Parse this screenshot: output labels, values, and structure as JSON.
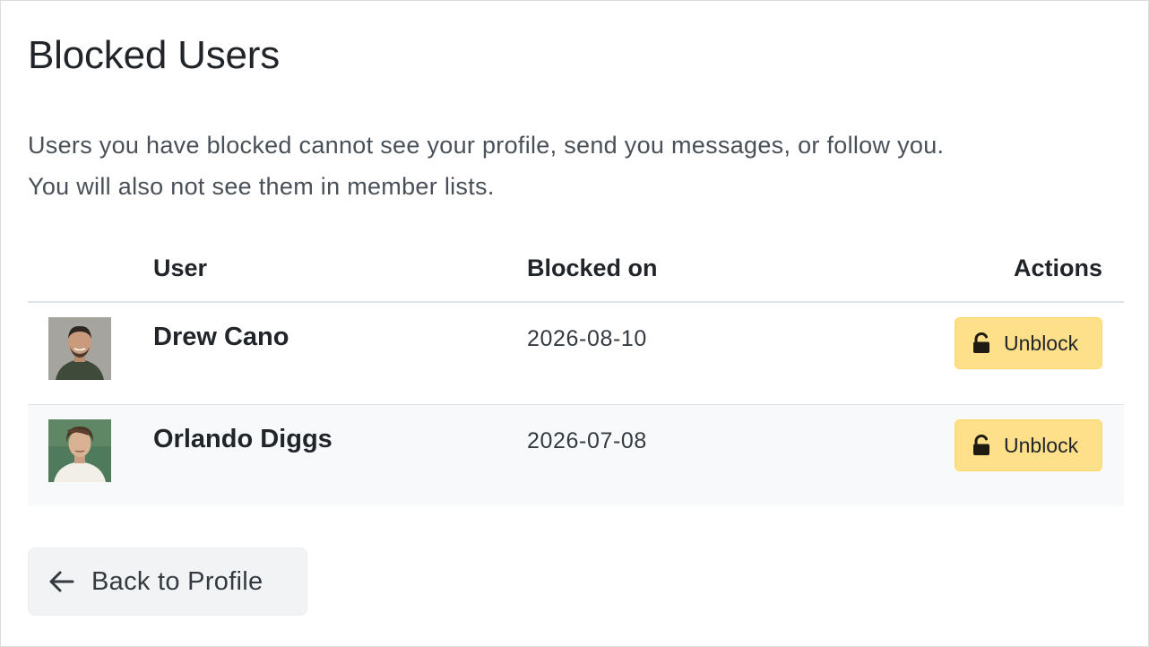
{
  "page": {
    "title": "Blocked Users",
    "description_line1": "Users you have blocked cannot see your profile, send you messages, or follow you.",
    "description_line2": "You will also not see them in member lists."
  },
  "table": {
    "headers": {
      "user": "User",
      "blocked_on": "Blocked on",
      "actions": "Actions"
    },
    "rows": [
      {
        "name": "Drew Cano",
        "blocked_on": "2026-08-10",
        "action_label": "Unblock",
        "action_icon": "unlock-icon",
        "avatar_colors": {
          "background": "#9a9a96",
          "skin": "#c99a7c",
          "hair": "#2e2622",
          "shirt": "#3f4a3a"
        }
      },
      {
        "name": "Orlando Diggs",
        "blocked_on": "2026-07-08",
        "action_label": "Unblock",
        "action_icon": "unlock-icon",
        "avatar_colors": {
          "background": "#4f7a5c",
          "skin": "#d9b293",
          "hair": "#4a3424",
          "shirt": "#f2eee8"
        }
      }
    ]
  },
  "footer": {
    "back_label": "Back to Profile",
    "back_icon": "arrow-left-icon"
  },
  "colors": {
    "unblock_button": "#ffe08a",
    "back_button": "#f1f3f5",
    "row_stripe": "#f8f9fa",
    "border": "#dee2e6"
  }
}
